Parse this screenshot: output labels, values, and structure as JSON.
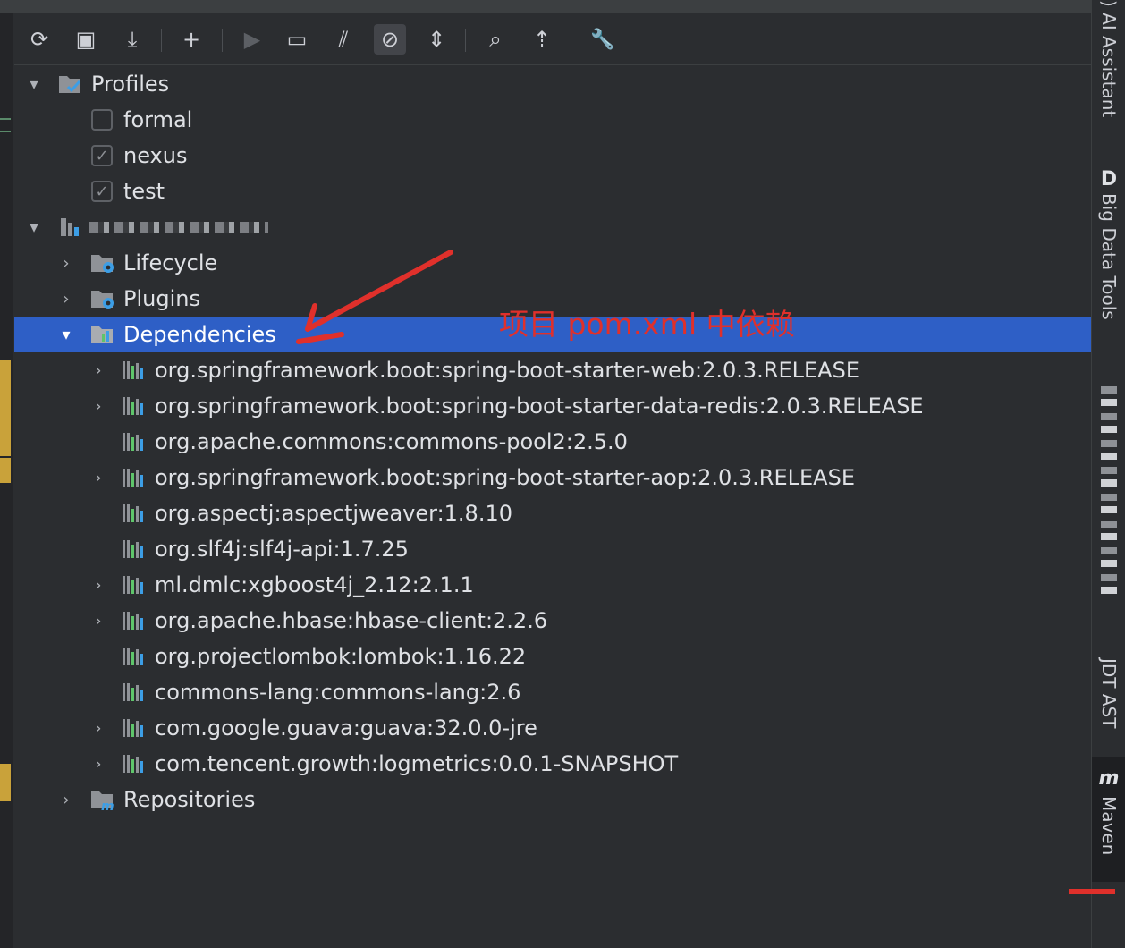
{
  "toolbar": {
    "buttons": [
      {
        "icon": "reload-icon",
        "glyph": "⟳"
      },
      {
        "icon": "reimport-folder-icon",
        "glyph": "▣"
      },
      {
        "icon": "download-sources-icon",
        "glyph": "⤓"
      },
      {
        "icon": "add-icon",
        "glyph": "+"
      },
      {
        "icon": "run-icon",
        "glyph": "▶"
      },
      {
        "icon": "execute-goal-icon",
        "glyph": "▭"
      },
      {
        "icon": "toggle-offline-icon",
        "glyph": "⫽"
      },
      {
        "icon": "skip-tests-icon",
        "glyph": "⊘"
      },
      {
        "icon": "collapse-all-icon",
        "glyph": "⇕"
      },
      {
        "icon": "analyze-dependencies-icon",
        "glyph": "⌕"
      },
      {
        "icon": "show-diagram-icon",
        "glyph": "⇡"
      },
      {
        "icon": "settings-wrench-icon",
        "glyph": "🔧"
      }
    ]
  },
  "tree": {
    "profiles_label": "Profiles",
    "profiles": [
      {
        "name": "formal",
        "checked": false,
        "mark": ""
      },
      {
        "name": "nexus",
        "checked": true,
        "mark": "✓"
      },
      {
        "name": "test",
        "checked": true,
        "mark": "✓"
      }
    ],
    "lifecycle_label": "Lifecycle",
    "plugins_label": "Plugins",
    "dependencies_label": "Dependencies",
    "dependencies": [
      {
        "label": "org.springframework.boot:spring-boot-starter-web:2.0.3.RELEASE",
        "expandable": true
      },
      {
        "label": "org.springframework.boot:spring-boot-starter-data-redis:2.0.3.RELEASE",
        "expandable": true
      },
      {
        "label": "org.apache.commons:commons-pool2:2.5.0",
        "expandable": false
      },
      {
        "label": "org.springframework.boot:spring-boot-starter-aop:2.0.3.RELEASE",
        "expandable": true
      },
      {
        "label": "org.aspectj:aspectjweaver:1.8.10",
        "expandable": false
      },
      {
        "label": "org.slf4j:slf4j-api:1.7.25",
        "expandable": false
      },
      {
        "label": "ml.dmlc:xgboost4j_2.12:2.1.1",
        "expandable": true
      },
      {
        "label": "org.apache.hbase:hbase-client:2.2.6",
        "expandable": true
      },
      {
        "label": "org.projectlombok:lombok:1.16.22",
        "expandable": false
      },
      {
        "label": "commons-lang:commons-lang:2.6",
        "expandable": false
      },
      {
        "label": "com.google.guava:guava:32.0.0-jre",
        "expandable": true
      },
      {
        "label": "com.tencent.growth:logmetrics:0.0.1-SNAPSHOT",
        "expandable": true
      }
    ],
    "repositories_label": "Repositories"
  },
  "annotation": {
    "text": "项目 pom.xml 中依赖",
    "color": "#e0302b"
  },
  "right_sidebar": {
    "ai_assistant": ") AI Assistant",
    "big_data_letter": "D",
    "big_data_tools": "Big Data Tools",
    "jdt_ast": "JDT AST",
    "maven_letter": "m",
    "maven": "Maven"
  },
  "colors": {
    "background": "#2b2d30",
    "selection": "#2e5fc6",
    "text": "#dfe1e5"
  }
}
